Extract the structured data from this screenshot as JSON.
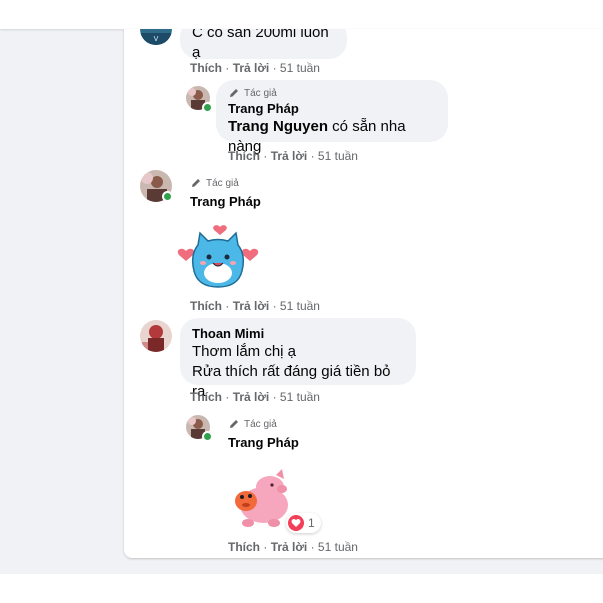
{
  "comments": [
    {
      "text": "C có sẵn 200ml luôn ạ",
      "actions": {
        "like": "Thích",
        "sep1": "·",
        "reply": "Trả lời",
        "sep2": "·",
        "time": "51 tuần"
      }
    },
    {
      "author_tag": "Tác giả",
      "name": "Trang Pháp",
      "mention": "Trang Nguyen",
      "text": " có sẵn nha nàng",
      "actions": {
        "like": "Thích",
        "sep1": "·",
        "reply": "Trả lời",
        "sep2": "·",
        "time": "51 tuần"
      }
    },
    {
      "author_tag": "Tác giả",
      "name": "Trang Pháp",
      "sticker": "blue-cat-hearts-sticker",
      "actions": {
        "like": "Thích",
        "sep1": "·",
        "reply": "Trả lời",
        "sep2": "·",
        "time": "51 tuần"
      }
    },
    {
      "name": "Thoan Mimi",
      "line1": "Thơm lắm chị ạ",
      "line2": "Rửa thích rất đáng giá tiền bỏ ra",
      "actions": {
        "like": "Thích",
        "sep1": "·",
        "reply": "Trả lời",
        "sep2": "·",
        "time": "51 tuần"
      }
    },
    {
      "author_tag": "Tác giả",
      "name": "Trang Pháp",
      "sticker": "pink-pig-hug-sticker",
      "reaction_count": "1",
      "actions": {
        "like": "Thích",
        "sep1": "·",
        "reply": "Trả lời",
        "sep2": "·",
        "time": "51 tuần"
      }
    }
  ],
  "colors": {
    "online": "#31a24c",
    "bubble": "#f0f2f5",
    "meta": "#65676b",
    "heart": "#f33e58"
  }
}
